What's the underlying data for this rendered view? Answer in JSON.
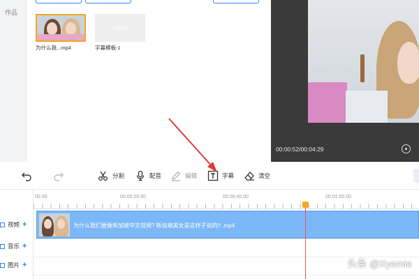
{
  "sidebar": {
    "label": "作品"
  },
  "library": {
    "items": [
      {
        "label": "为什么我...mp4",
        "type": "video"
      },
      {
        "label": "字幕模板-1",
        "type": "subtitle",
        "thumb_text": "字幕示例"
      }
    ]
  },
  "player": {
    "time": "00:00:52/00:04:29"
  },
  "toolbar": {
    "undo_icon": "undo-icon",
    "redo_icon": "redo-icon",
    "split": "分割",
    "dub": "配音",
    "edit": "编辑",
    "subtitle": "字幕",
    "clear": "清空"
  },
  "timeline": {
    "ruler": [
      "00.00",
      "00:00:20.00",
      "00:00:40.00",
      "00:01:00.00"
    ],
    "tracks": [
      {
        "name": "视频"
      },
      {
        "name": "音乐"
      },
      {
        "name": "图片"
      }
    ],
    "clip_text": "为什么我们要做新加坡中文视频? 新加坡美女是这样子说的!! .mp4"
  },
  "watermark": "头条 @Xyemie",
  "colors": {
    "accent": "#2f83ff",
    "clip": "#7cb8f7",
    "playhead": "#f05050",
    "highlight": "#f5a623"
  }
}
